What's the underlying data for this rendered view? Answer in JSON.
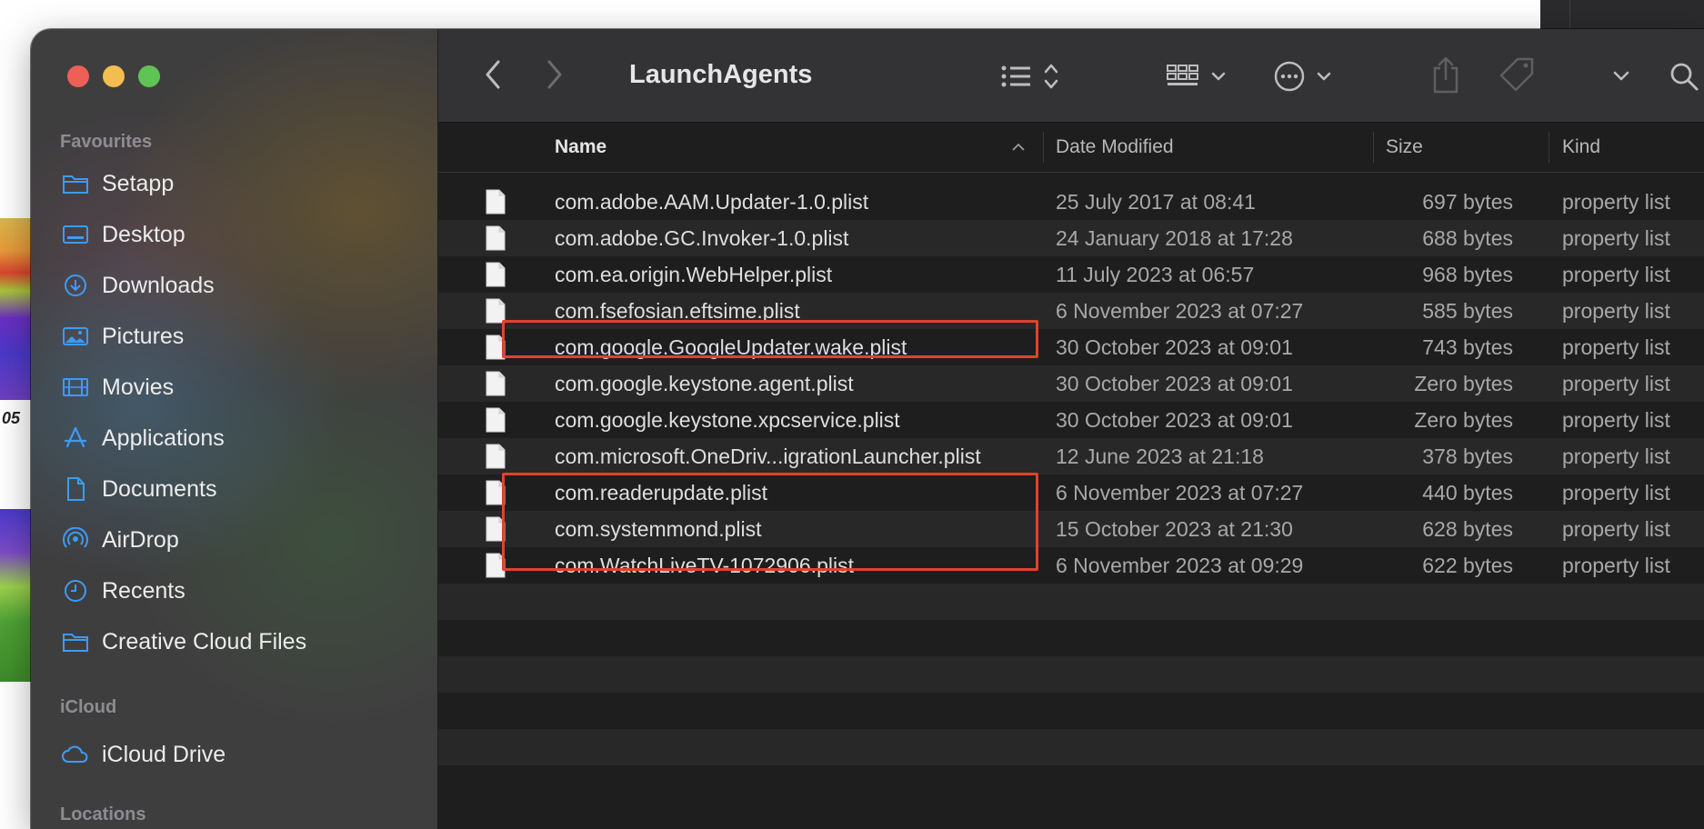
{
  "window": {
    "title": "LaunchAgents"
  },
  "sidebar": {
    "sections": [
      {
        "label": "Favourites"
      },
      {
        "label": "iCloud"
      },
      {
        "label": "Locations"
      }
    ],
    "favourites": [
      {
        "label": "Setapp",
        "icon": "folder-icon"
      },
      {
        "label": "Desktop",
        "icon": "desktop-icon"
      },
      {
        "label": "Downloads",
        "icon": "downloads-icon"
      },
      {
        "label": "Pictures",
        "icon": "pictures-icon"
      },
      {
        "label": "Movies",
        "icon": "movies-icon"
      },
      {
        "label": "Applications",
        "icon": "applications-icon"
      },
      {
        "label": "Documents",
        "icon": "document-icon"
      },
      {
        "label": "AirDrop",
        "icon": "airdrop-icon"
      },
      {
        "label": "Recents",
        "icon": "clock-icon"
      },
      {
        "label": "Creative Cloud Files",
        "icon": "folder-icon"
      }
    ],
    "icloud": [
      {
        "label": "iCloud Drive",
        "icon": "cloud-icon"
      }
    ]
  },
  "columns": {
    "name": "Name",
    "date": "Date Modified",
    "size": "Size",
    "kind": "Kind"
  },
  "files": [
    {
      "name": "com.adobe.AAM.Updater-1.0.plist",
      "date": "25 July 2017 at 08:41",
      "size": "697 bytes",
      "kind": "property list"
    },
    {
      "name": "com.adobe.GC.Invoker-1.0.plist",
      "date": "24 January 2018 at 17:28",
      "size": "688 bytes",
      "kind": "property list"
    },
    {
      "name": "com.ea.origin.WebHelper.plist",
      "date": "11 July 2023 at 06:57",
      "size": "968 bytes",
      "kind": "property list"
    },
    {
      "name": "com.fsefosian.eftsime.plist",
      "date": "6 November 2023 at 07:27",
      "size": "585 bytes",
      "kind": "property list"
    },
    {
      "name": "com.google.GoogleUpdater.wake.plist",
      "date": "30 October 2023 at 09:01",
      "size": "743 bytes",
      "kind": "property list"
    },
    {
      "name": "com.google.keystone.agent.plist",
      "date": "30 October 2023 at 09:01",
      "size": "Zero bytes",
      "kind": "property list"
    },
    {
      "name": "com.google.keystone.xpcservice.plist",
      "date": "30 October 2023 at 09:01",
      "size": "Zero bytes",
      "kind": "property list"
    },
    {
      "name": "com.microsoft.OneDriv...igrationLauncher.plist",
      "date": "12 June 2023 at 21:18",
      "size": "378 bytes",
      "kind": "property list"
    },
    {
      "name": "com.readerupdate.plist",
      "date": "6 November 2023 at 07:27",
      "size": "440 bytes",
      "kind": "property list"
    },
    {
      "name": "com.systemmond.plist",
      "date": "15 October 2023 at 21:30",
      "size": "628 bytes",
      "kind": "property list"
    },
    {
      "name": "com.WatchLiveTV-1072906.plist",
      "date": "6 November 2023 at 09:29",
      "size": "622 bytes",
      "kind": "property list"
    }
  ],
  "background_labels": [
    "05",
    "05"
  ],
  "colors": {
    "highlight": "#e0432b",
    "accent": "#3d9bf6"
  }
}
